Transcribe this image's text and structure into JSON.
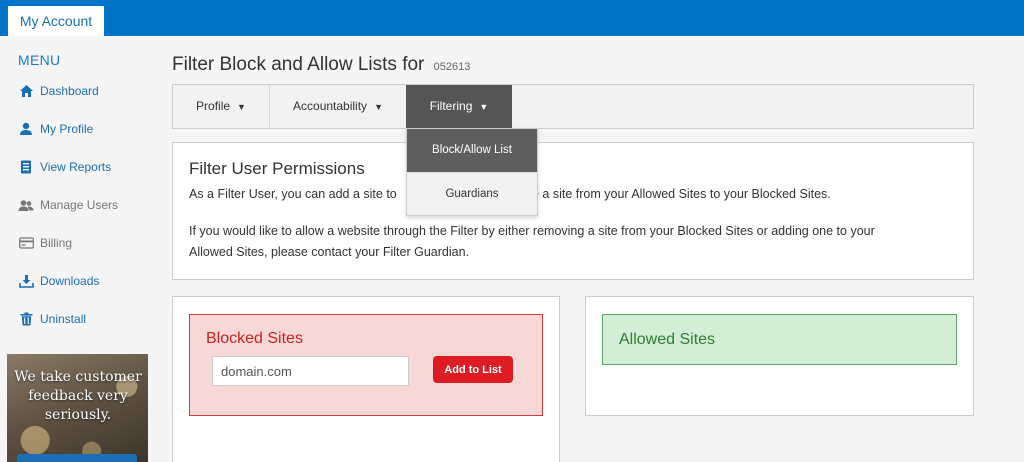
{
  "topbar": {
    "account_tab": "My Account"
  },
  "sidebar": {
    "menu_title": "MENU",
    "items": [
      {
        "label": "Dashboard",
        "icon": "home-icon"
      },
      {
        "label": "My Profile",
        "icon": "user-icon"
      },
      {
        "label": "View Reports",
        "icon": "report-icon"
      },
      {
        "label": "Manage Users",
        "icon": "users-icon"
      },
      {
        "label": "Billing",
        "icon": "credit-card-icon"
      },
      {
        "label": "Downloads",
        "icon": "download-icon"
      },
      {
        "label": "Uninstall",
        "icon": "trash-icon"
      }
    ],
    "promo": {
      "text": "We take customer feedback very seriously."
    }
  },
  "header": {
    "title": "Filter Block and Allow Lists for",
    "account_id": "052613"
  },
  "nav": {
    "tabs": [
      {
        "label": "Profile",
        "caret": "▼"
      },
      {
        "label": "Accountability",
        "caret": "▼"
      },
      {
        "label": "Filtering",
        "caret": "▼"
      }
    ],
    "active_tab": "Filtering",
    "dropdown": [
      {
        "label": "Block/Allow List"
      },
      {
        "label": "Guardians"
      }
    ]
  },
  "permissions": {
    "title": "Filter User Permissions",
    "line1_start": "As a Filter User, you can add a site to",
    "line1_end": "r move a site from your Allowed Sites to your Blocked Sites.",
    "paragraph2_line1": "If you would like to allow a website through the Filter by either removing a site from your Blocked Sites or adding one to your",
    "paragraph2_line2": "Allowed Sites, please contact your Filter Guardian."
  },
  "blocked": {
    "title": "Blocked Sites",
    "input_value": "domain.com",
    "add_button": "Add to List"
  },
  "allowed": {
    "title": "Allowed Sites"
  },
  "colors": {
    "brand_blue": "#0073c6",
    "blocked_red": "#cc2222",
    "allowed_green": "#2e7d32",
    "add_button": "#dd1c24"
  }
}
